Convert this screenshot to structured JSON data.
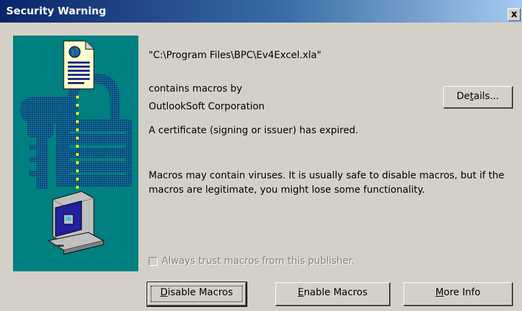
{
  "window": {
    "title": "Security Warning",
    "close_label": "x"
  },
  "message": {
    "file_path": "\"C:\\Program Files\\BPC\\Ev4Excel.xla\"",
    "contains_label": "contains macros by",
    "publisher": "OutlookSoft Corporation",
    "certificate_warning": "A certificate (signing or issuer) has expired.",
    "virus_warning_line1": "Macros may contain viruses. It is usually safe to disable macros, but if the",
    "virus_warning_line2": "macros are legitimate, you might lose some functionality."
  },
  "details_button": {
    "pre": "De",
    "accel": "t",
    "post": "ails..."
  },
  "trust_checkbox": {
    "label": "Always trust macros from this publisher.",
    "checked": false,
    "enabled": false
  },
  "buttons": {
    "disable": {
      "accel": "D",
      "post": "isable Macros"
    },
    "enable": {
      "accel": "E",
      "post": "nable Macros"
    },
    "more_info": {
      "accel": "M",
      "post": "ore Info"
    }
  },
  "colors": {
    "title_start": "#0a246a",
    "title_end": "#a6caf0",
    "art_bg": "#008080",
    "face": "#d4d0c8"
  },
  "icons": [
    "document-globe-icon",
    "padlock-key-icon",
    "computer-icon"
  ]
}
